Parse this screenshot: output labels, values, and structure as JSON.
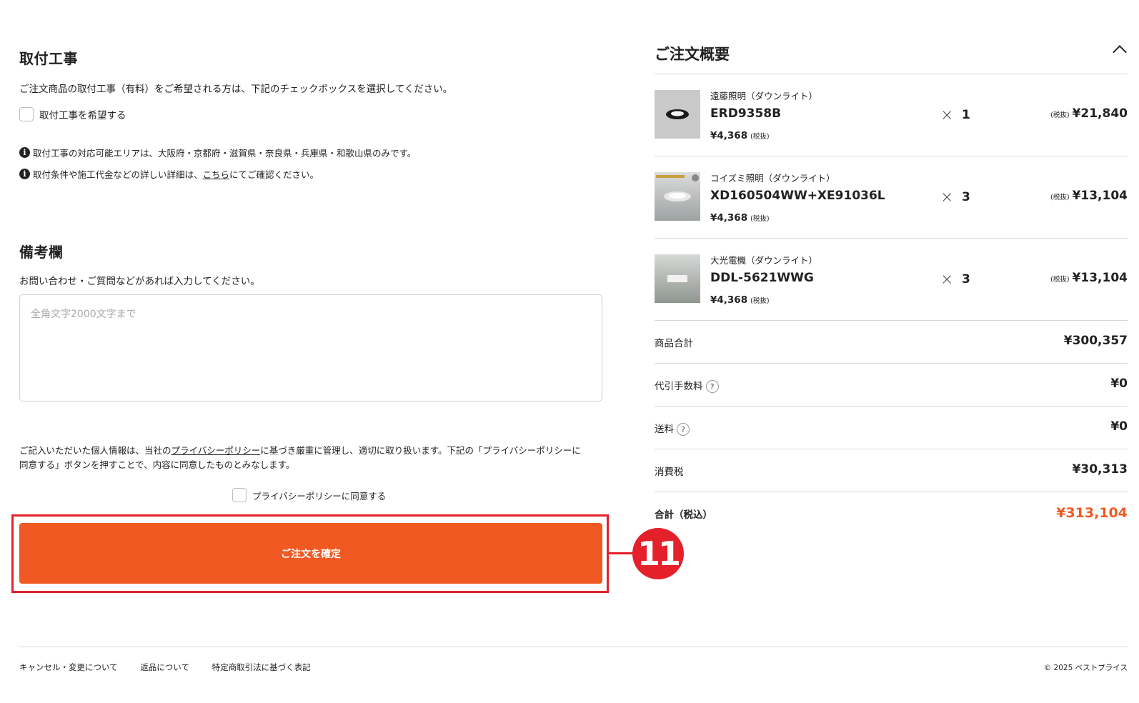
{
  "install": {
    "title": "取付工事",
    "description": "ご注文商品の取付工事（有料）をご希望される方は、下記のチェックボックスを選択してください。",
    "checkbox_label": "取付工事を希望する",
    "note1": "取付工事の対応可能エリアは、大阪府・京都府・滋賀県・奈良県・兵庫県・和歌山県のみです。",
    "note2_prefix": "取付条件や施工代金などの詳しい詳細は、",
    "note2_link": "こちら",
    "note2_suffix": "にてご確認ください。",
    "info_icon_glyph": "i"
  },
  "remarks": {
    "title": "備考欄",
    "description": "お問い合わせ・ご質問などがあれば入力してください。",
    "placeholder": "全角文字2000文字まで",
    "value": ""
  },
  "privacy": {
    "text_prefix": "ご記入いただいた個人情報は、当社の",
    "link": "プライバシーポリシー",
    "text_suffix_line1": "に基づき厳重に管理し、適切に取り扱います。下記の「プライバシーポリシーに",
    "text_line2": "同意する」ボタンを押すことで、内容に同意したものとみなします。",
    "checkbox_label": "プライバシーポリシーに同意する"
  },
  "confirm_button": {
    "label": "ご注文を確定"
  },
  "annotation": {
    "step_number": "11",
    "color": "#e4202a"
  },
  "summary": {
    "title": "ご注文概要",
    "toggle_icon": "chevron-up-icon",
    "items": [
      {
        "brand": "遠藤照明（ダウンライト）",
        "model": "ERD9358B",
        "unit_price": "¥4,368",
        "unit_tax_note": "(税抜)",
        "qty_mark": "×",
        "qty": "1",
        "price_tax_note": "(税抜)",
        "price": "¥21,840"
      },
      {
        "brand": "コイズミ照明（ダウンライト）",
        "model": "XD160504WW+XE91036L",
        "unit_price": "¥4,368",
        "unit_tax_note": "(税抜)",
        "qty_mark": "×",
        "qty": "3",
        "price_tax_note": "(税抜)",
        "price": "¥13,104"
      },
      {
        "brand": "大光電機（ダウンライト）",
        "model": "DDL-5621WWG",
        "unit_price": "¥4,368",
        "unit_tax_note": "(税抜)",
        "qty_mark": "×",
        "qty": "3",
        "price_tax_note": "(税抜)",
        "price": "¥13,104"
      }
    ],
    "subtotal_label": "商品合計",
    "subtotal_value": "¥300,357",
    "cod_fee_label": "代引手数料",
    "cod_fee_value": "¥0",
    "shipping_label": "送料",
    "shipping_value": "¥0",
    "tax_label": "消費税",
    "tax_value": "¥30,313",
    "total_label": "合計（税込）",
    "total_value": "¥313,104",
    "help_glyph": "?",
    "accent_color": "#f05a22"
  },
  "footer": {
    "links": [
      "キャンセル・変更について",
      "返品について",
      "特定商取引法に基づく表記"
    ],
    "copyright": "© 2025 ベストプライス"
  }
}
